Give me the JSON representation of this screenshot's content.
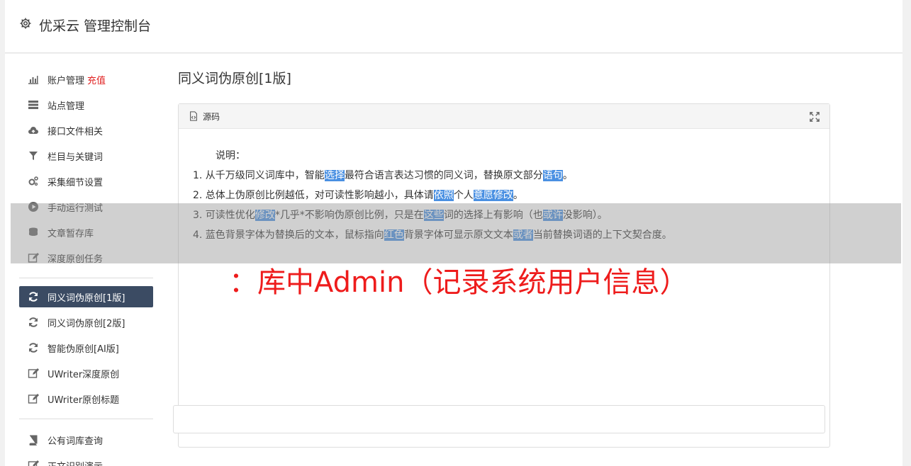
{
  "header": {
    "title": "优采云 管理控制台",
    "icon": "gear-icon"
  },
  "sidebar": {
    "group1": [
      {
        "label": "账户管理",
        "extra": "充值",
        "icon": "bar-chart-icon"
      },
      {
        "label": "站点管理",
        "icon": "server-icon"
      },
      {
        "label": "接口文件相关",
        "icon": "cloud-upload-icon"
      },
      {
        "label": "栏目与关键词",
        "icon": "filter-icon"
      },
      {
        "label": "采集细节设置",
        "icon": "cogs-icon"
      },
      {
        "label": "手动运行测试",
        "icon": "play-circle-icon"
      },
      {
        "label": "文章暂存库",
        "icon": "database-icon"
      },
      {
        "label": "深度原创任务",
        "icon": "edit-icon"
      }
    ],
    "group2": [
      {
        "label": "同义词伪原创[1版]",
        "icon": "refresh-icon",
        "active": true
      },
      {
        "label": "同义词伪原创[2版]",
        "icon": "refresh-icon"
      },
      {
        "label": "智能伪原创[AI版]",
        "icon": "refresh-icon"
      },
      {
        "label": "UWriter深度原创",
        "icon": "edit-icon"
      },
      {
        "label": "UWriter原创标题",
        "icon": "edit-icon"
      }
    ],
    "group3": [
      {
        "label": "公有词库查询",
        "icon": "book-icon"
      },
      {
        "label": "正文识别演示",
        "icon": "edit-icon"
      }
    ]
  },
  "content": {
    "page_title": "同义词伪原创[1版]",
    "panel_title": "源码",
    "explain": "说明：",
    "lines": [
      {
        "pre": "1. 从千万级同义词库中，智能",
        "h1": "选择",
        "mid": "最符合语言表达习惯的同义词，替换原文部分",
        "h2": "语句",
        "post": "。"
      },
      {
        "pre": "2. 总体上伪原创比例越低，对可读性影响越小，具体请",
        "h1": "依照",
        "mid": "个人",
        "h2": "意愿",
        "h3": "修改",
        "post": "。"
      },
      {
        "pre": "3. 可读性优化",
        "h1": "修改",
        "mid": "*几乎*不影响伪原创比例，只是在",
        "h2": "这些",
        "mid2": "词的选择上有影响（也",
        "h3": "或许",
        "post": "没影响）。"
      },
      {
        "pre": "4. 蓝色背景字体为替换后的文本，鼠标指向",
        "h1": "红色",
        "mid": "背景字体可显示原文文本",
        "h2": "或者",
        "post": "当前替换词语的上下文契合度。"
      }
    ]
  },
  "overlay": {
    "text": "：库中Admin（记录系统用户信息）"
  },
  "colors": {
    "active_bg": "#3b4b63",
    "highlight": "#4a90e2",
    "overlay_text": "#ee1c1c",
    "recharge": "#e02020"
  }
}
